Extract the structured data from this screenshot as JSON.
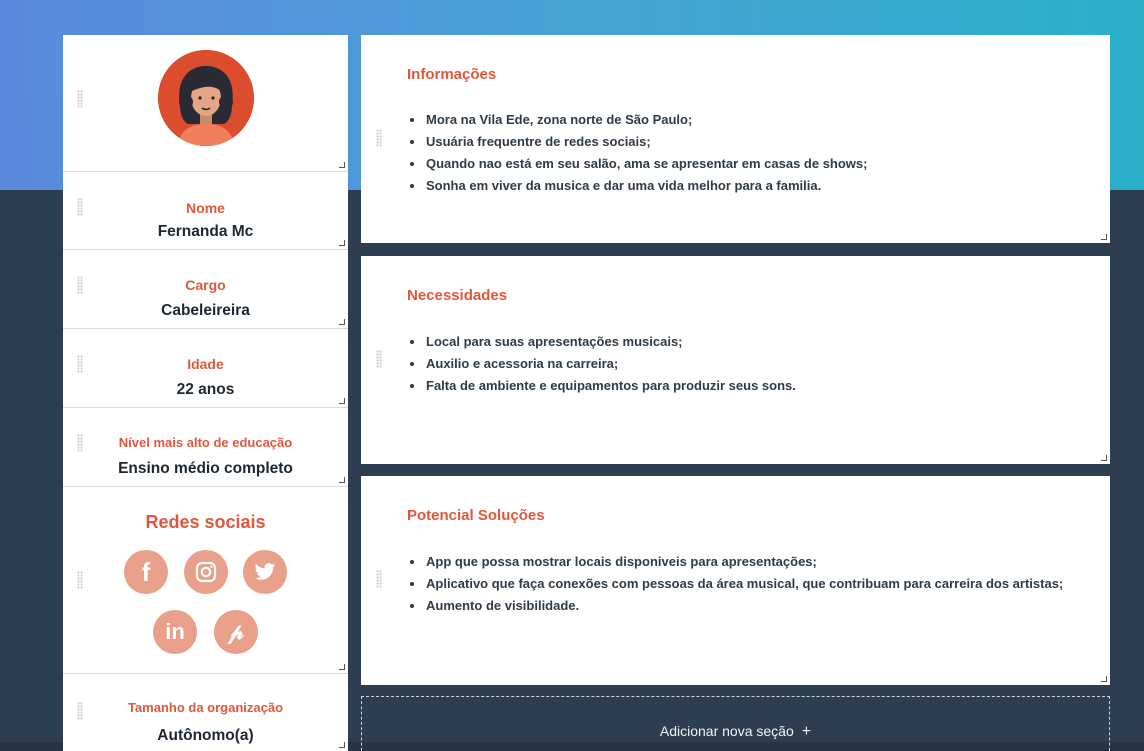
{
  "profile": {
    "name_label": "Nome",
    "name_value": "Fernanda Mc",
    "role_label": "Cargo",
    "role_value": "Cabeleireira",
    "age_label": "Idade",
    "age_value": "22 anos",
    "education_label": "Nível mais alto de educação",
    "education_value": "Ensino médio completo",
    "social_title": "Redes sociais",
    "social_icons": [
      "facebook-icon",
      "instagram-icon",
      "twitter-icon",
      "linkedin-icon",
      "pinterest-icon"
    ],
    "org_label": "Tamanho da organização",
    "org_value": "Autônomo(a)"
  },
  "sections": [
    {
      "title": "Informações",
      "items": [
        "Mora na Vila Ede, zona norte de São Paulo;",
        "Usuária frequentre de redes sociais;",
        "Quando nao está em seu salão, ama se apresentar em casas de shows;",
        "Sonha em viver da musica e dar uma vida melhor para a familia."
      ]
    },
    {
      "title": "Necessidades",
      "items": [
        "Local para suas apresentações musicais;",
        "Auxilio e acessoria na carreira;",
        "Falta de ambiente e equipamentos para produzir seus sons."
      ]
    },
    {
      "title": "Potencial Soluções",
      "items": [
        "App que possa mostrar locais disponiveis para apresentações;",
        "Aplicativo que faça conexões com pessoas da área musical, que contribuam para carreira dos artistas;",
        "Aumento de visibilidade."
      ]
    }
  ],
  "add_section_label": "Adicionar nova seção",
  "add_section_plus": "+",
  "colors": {
    "accent": "#e0573d",
    "social_icon_bg": "#e9a08a",
    "background_dark": "#2d3e50"
  }
}
